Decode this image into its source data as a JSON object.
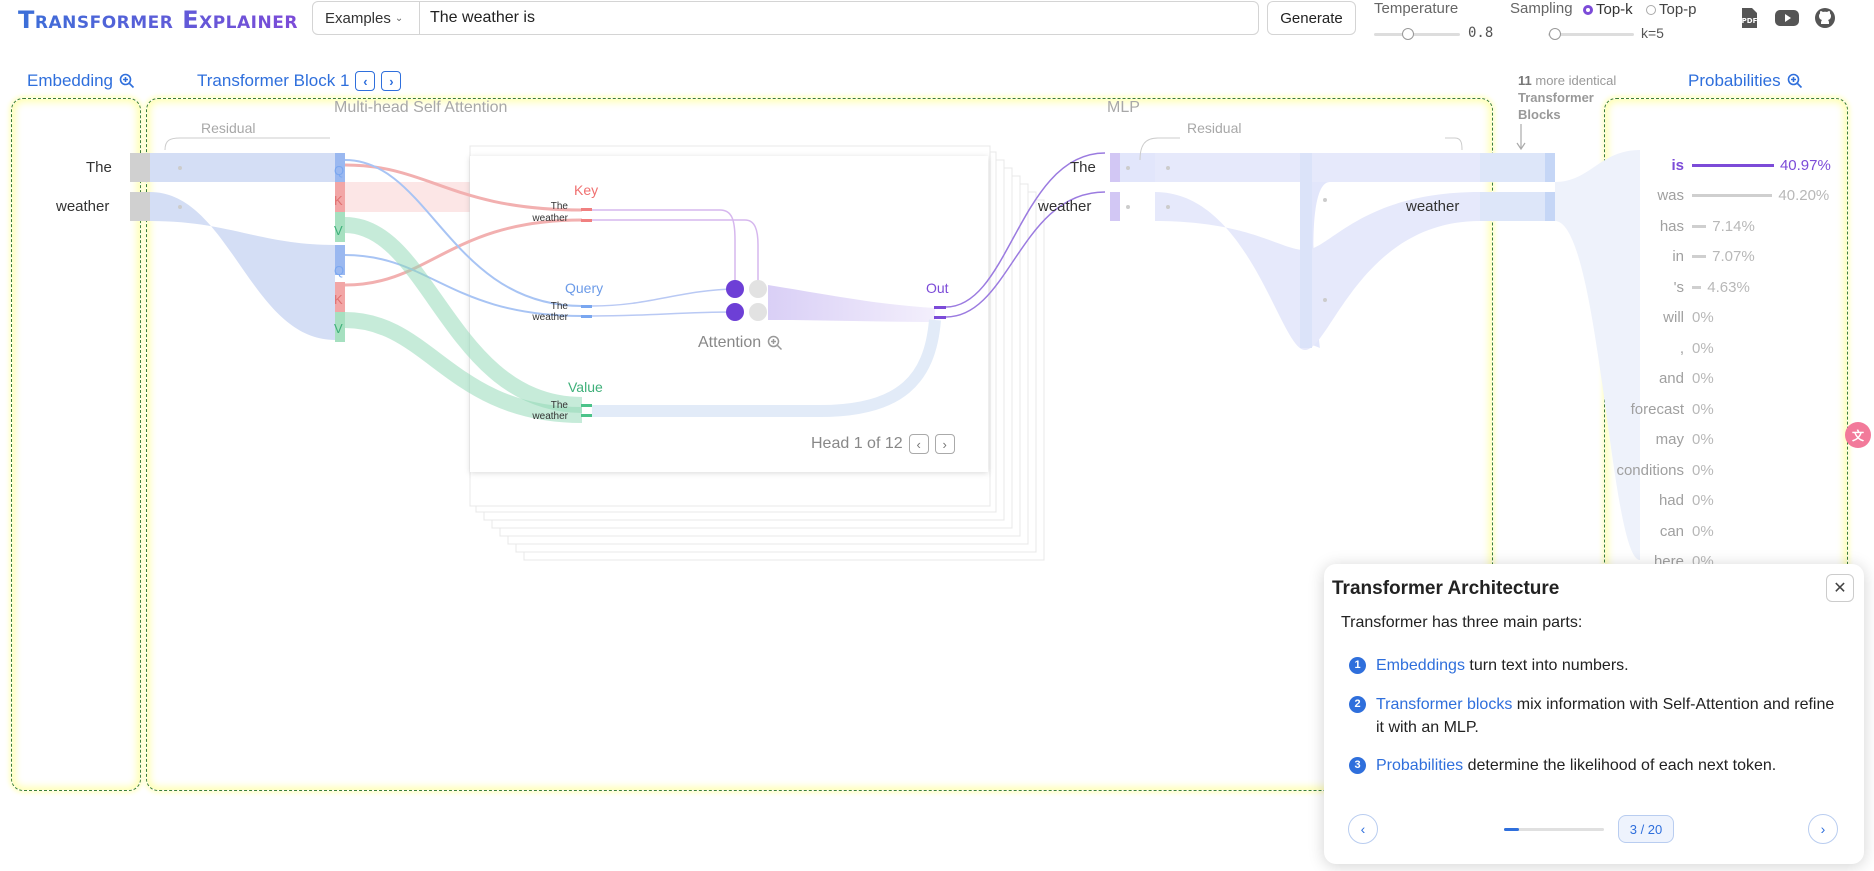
{
  "header": {
    "logo": "Transformer Explainer",
    "examples_label": "Examples",
    "prompt_value": "The weather is",
    "generate_label": "Generate",
    "temperature_label": "Temperature",
    "temperature_value": "0.8",
    "temperature_fraction": 0.4,
    "sampling_label": "Sampling",
    "topk_label": "Top-k",
    "topp_label": "Top-p",
    "k_value": "k=5",
    "k_fraction": 0.08,
    "icons": [
      "pdf-icon",
      "youtube-icon",
      "github-icon"
    ]
  },
  "sections": {
    "embedding": "Embedding",
    "transformer_block": "Transformer Block 1",
    "more_blocks_count": "11",
    "more_blocks_text": "more identical",
    "more_blocks_bold": "Transformer Blocks",
    "probabilities": "Probabilities"
  },
  "embedding_tokens": [
    "The",
    "weather"
  ],
  "block": {
    "residual_1": "Residual",
    "mha": "Multi-head Self Attention",
    "mlp": "MLP",
    "residual_2": "Residual",
    "qkv": [
      "Q",
      "K",
      "V",
      "Q",
      "K",
      "V"
    ],
    "key_label": "Key",
    "query_label": "Query",
    "value_label": "Value",
    "out_label": "Out",
    "attention_label": "Attention",
    "head_label": "Head 1 of 12",
    "mini_tokens": [
      "The",
      "weather"
    ],
    "mlp_tokens": [
      "The",
      "weather"
    ],
    "output_token": "weather"
  },
  "probabilities": [
    {
      "token": "is",
      "value": "40.97%",
      "fraction": 0.4097,
      "selected": true
    },
    {
      "token": "was",
      "value": "40.20%",
      "fraction": 0.402
    },
    {
      "token": "has",
      "value": "7.14%",
      "fraction": 0.0714
    },
    {
      "token": "in",
      "value": "7.07%",
      "fraction": 0.0707
    },
    {
      "token": "'s",
      "value": "4.63%",
      "fraction": 0.0463
    },
    {
      "token": "will",
      "value": "0%",
      "fraction": 0
    },
    {
      "token": ",",
      "value": "0%",
      "fraction": 0
    },
    {
      "token": "and",
      "value": "0%",
      "fraction": 0
    },
    {
      "token": "forecast",
      "value": "0%",
      "fraction": 0
    },
    {
      "token": "may",
      "value": "0%",
      "fraction": 0
    },
    {
      "token": "conditions",
      "value": "0%",
      "fraction": 0
    },
    {
      "token": "had",
      "value": "0%",
      "fraction": 0
    },
    {
      "token": "can",
      "value": "0%",
      "fraction": 0
    },
    {
      "token": "here",
      "value": "0%",
      "fraction": 0
    }
  ],
  "tooltip": {
    "title": "Transformer Architecture",
    "intro": "Transformer has three main parts:",
    "items": [
      {
        "number": "1",
        "link": "Embeddings",
        "text": " turn text into numbers."
      },
      {
        "number": "2",
        "link": "Transformer blocks",
        "text": " mix information with Self-Attention and refine it with an MLP."
      },
      {
        "number": "3",
        "link": "Probabilities",
        "text": " determine the likelihood of each next token."
      }
    ],
    "page": "3 / 20",
    "progress_fraction": 0.15
  },
  "colors": {
    "accent_blue": "#2f6fdc",
    "accent_purple": "#7c4bd8",
    "query_blue": "#7aa7f0",
    "key_red": "#f08080",
    "value_green": "#4cc38a"
  }
}
